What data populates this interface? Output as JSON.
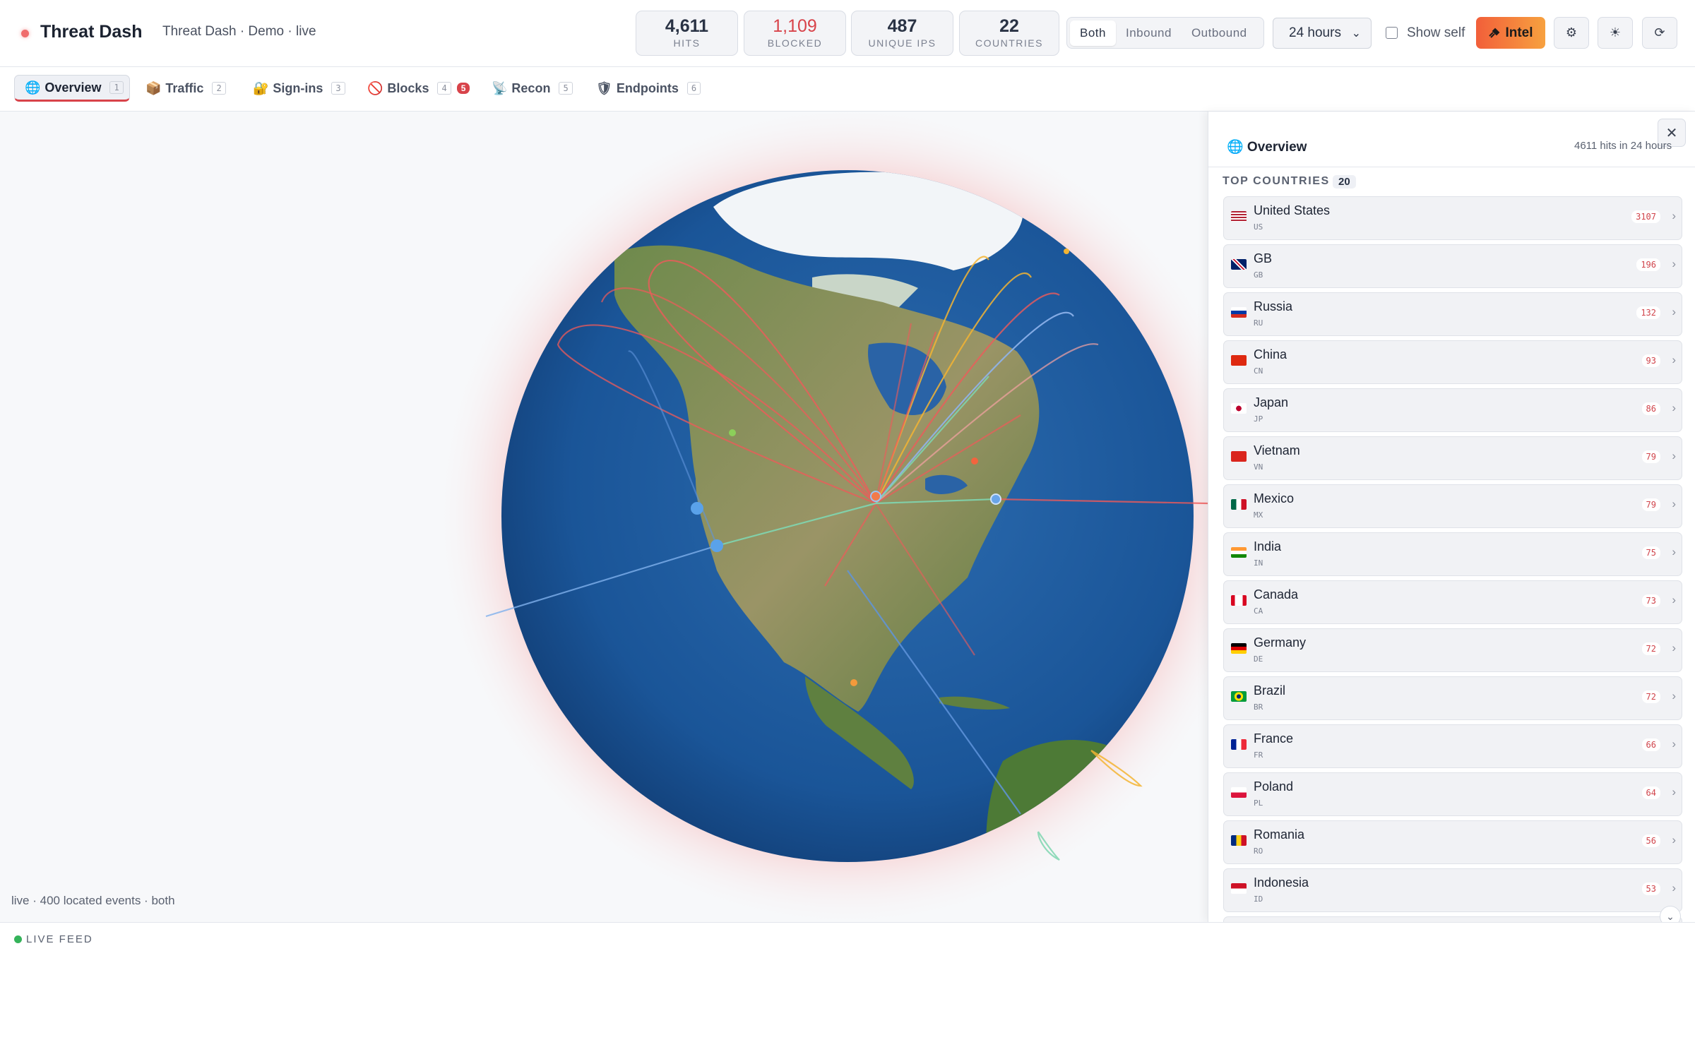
{
  "app": {
    "name": "Threat Dash",
    "subtitle": "Threat Dash · Demo · live"
  },
  "stats": [
    {
      "value": "4,611",
      "label": "HITS"
    },
    {
      "value": "1,109",
      "label": "BLOCKED"
    },
    {
      "value": "487",
      "label": "UNIQUE IPS"
    },
    {
      "value": "22",
      "label": "COUNTRIES"
    }
  ],
  "direction": {
    "options": [
      "Both",
      "Inbound",
      "Outbound"
    ],
    "selected": "Both"
  },
  "range": {
    "selected": "24 hours"
  },
  "show_self": {
    "label": "Show self",
    "checked": false
  },
  "intel": {
    "label": "Intel"
  },
  "tabs": [
    {
      "icon": "🌐",
      "label": "Overview",
      "key": "1"
    },
    {
      "icon": "📦",
      "label": "Traffic",
      "key": "2"
    },
    {
      "icon": "🔐",
      "label": "Sign-ins",
      "key": "3"
    },
    {
      "icon": "🚫",
      "label": "Blocks",
      "key": "4",
      "badge": "5"
    },
    {
      "icon": "📡",
      "label": "Recon",
      "key": "5"
    },
    {
      "icon": "🛡",
      "label": "Endpoints",
      "key": "6"
    }
  ],
  "globe": {
    "caption": "live · 400 located events · both"
  },
  "panel": {
    "title": "🌐 Overview",
    "meta": "4611 hits in 24 hours",
    "section_label": "TOP COUNTRIES",
    "section_count": "20",
    "countries": [
      {
        "name": "United States",
        "code": "US",
        "count": "3107"
      },
      {
        "name": "GB",
        "code": "GB",
        "count": "196"
      },
      {
        "name": "Russia",
        "code": "RU",
        "count": "132"
      },
      {
        "name": "China",
        "code": "CN",
        "count": "93"
      },
      {
        "name": "Japan",
        "code": "JP",
        "count": "86"
      },
      {
        "name": "Vietnam",
        "code": "VN",
        "count": "79"
      },
      {
        "name": "Mexico",
        "code": "MX",
        "count": "79"
      },
      {
        "name": "India",
        "code": "IN",
        "count": "75"
      },
      {
        "name": "Canada",
        "code": "CA",
        "count": "73"
      },
      {
        "name": "Germany",
        "code": "DE",
        "count": "72"
      },
      {
        "name": "Brazil",
        "code": "BR",
        "count": "72"
      },
      {
        "name": "France",
        "code": "FR",
        "count": "66"
      },
      {
        "name": "Poland",
        "code": "PL",
        "count": "64"
      },
      {
        "name": "Romania",
        "code": "RO",
        "count": "56"
      },
      {
        "name": "Indonesia",
        "code": "ID",
        "count": "53"
      }
    ]
  },
  "feed": {
    "label": "LIVE FEED"
  },
  "colors": {
    "accent": "#d8434a",
    "intel_from": "#f25f3a",
    "intel_to": "#f7a13f",
    "live": "#35b35a",
    "ocean": "#1e5b9c",
    "land": "#6e8c4a"
  }
}
